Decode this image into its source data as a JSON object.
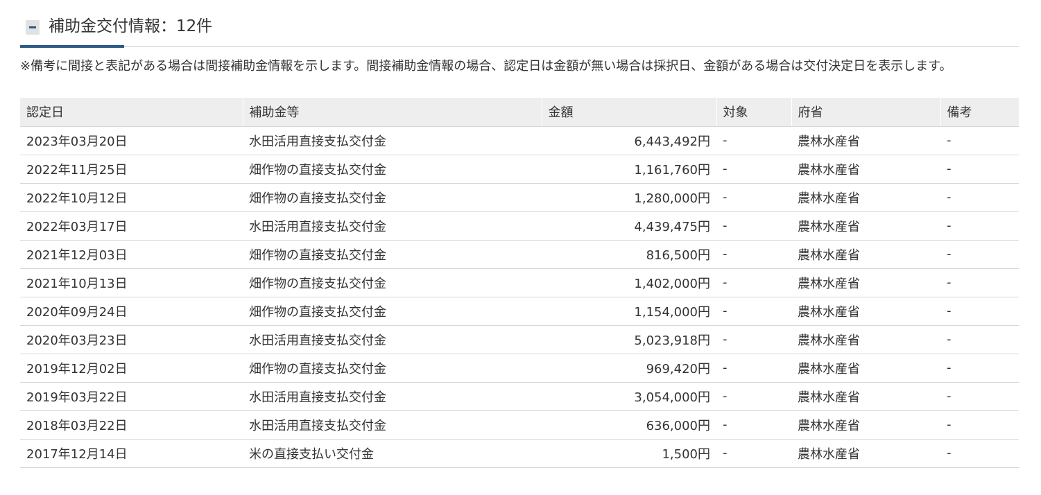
{
  "section": {
    "collapse_symbol": "-",
    "title": "補助金交付情報：12件",
    "note": "※備考に間接と表記がある場合は間接補助金情報を示します。間接補助金情報の場合、認定日は金額が無い場合は採択日、金額がある場合は交付決定日を表示します。"
  },
  "table": {
    "headers": [
      "認定日",
      "補助金等",
      "金額",
      "対象",
      "府省",
      "備考"
    ],
    "rows": [
      [
        "2023年03月20日",
        "水田活用直接支払交付金",
        "6,443,492円",
        "-",
        "農林水産省",
        "-"
      ],
      [
        "2022年11月25日",
        "畑作物の直接支払交付金",
        "1,161,760円",
        "-",
        "農林水産省",
        "-"
      ],
      [
        "2022年10月12日",
        "畑作物の直接支払交付金",
        "1,280,000円",
        "-",
        "農林水産省",
        "-"
      ],
      [
        "2022年03月17日",
        "水田活用直接支払交付金",
        "4,439,475円",
        "-",
        "農林水産省",
        "-"
      ],
      [
        "2021年12月03日",
        "畑作物の直接支払交付金",
        "816,500円",
        "-",
        "農林水産省",
        "-"
      ],
      [
        "2021年10月13日",
        "畑作物の直接支払交付金",
        "1,402,000円",
        "-",
        "農林水産省",
        "-"
      ],
      [
        "2020年09月24日",
        "畑作物の直接支払交付金",
        "1,154,000円",
        "-",
        "農林水産省",
        "-"
      ],
      [
        "2020年03月23日",
        "水田活用直接支払交付金",
        "5,023,918円",
        "-",
        "農林水産省",
        "-"
      ],
      [
        "2019年12月02日",
        "畑作物の直接支払交付金",
        "969,420円",
        "-",
        "農林水産省",
        "-"
      ],
      [
        "2019年03月22日",
        "水田活用直接支払交付金",
        "3,054,000円",
        "-",
        "農林水産省",
        "-"
      ],
      [
        "2018年03月22日",
        "水田活用直接支払交付金",
        "636,000円",
        "-",
        "農林水産省",
        "-"
      ],
      [
        "2017年12月14日",
        "米の直接支払い交付金",
        "1,500円",
        "-",
        "農林水産省",
        "-"
      ]
    ]
  },
  "colors": {
    "accent": "#2e5a88",
    "header_bg": "#eeeeee",
    "row_border": "#d6d6d6"
  }
}
